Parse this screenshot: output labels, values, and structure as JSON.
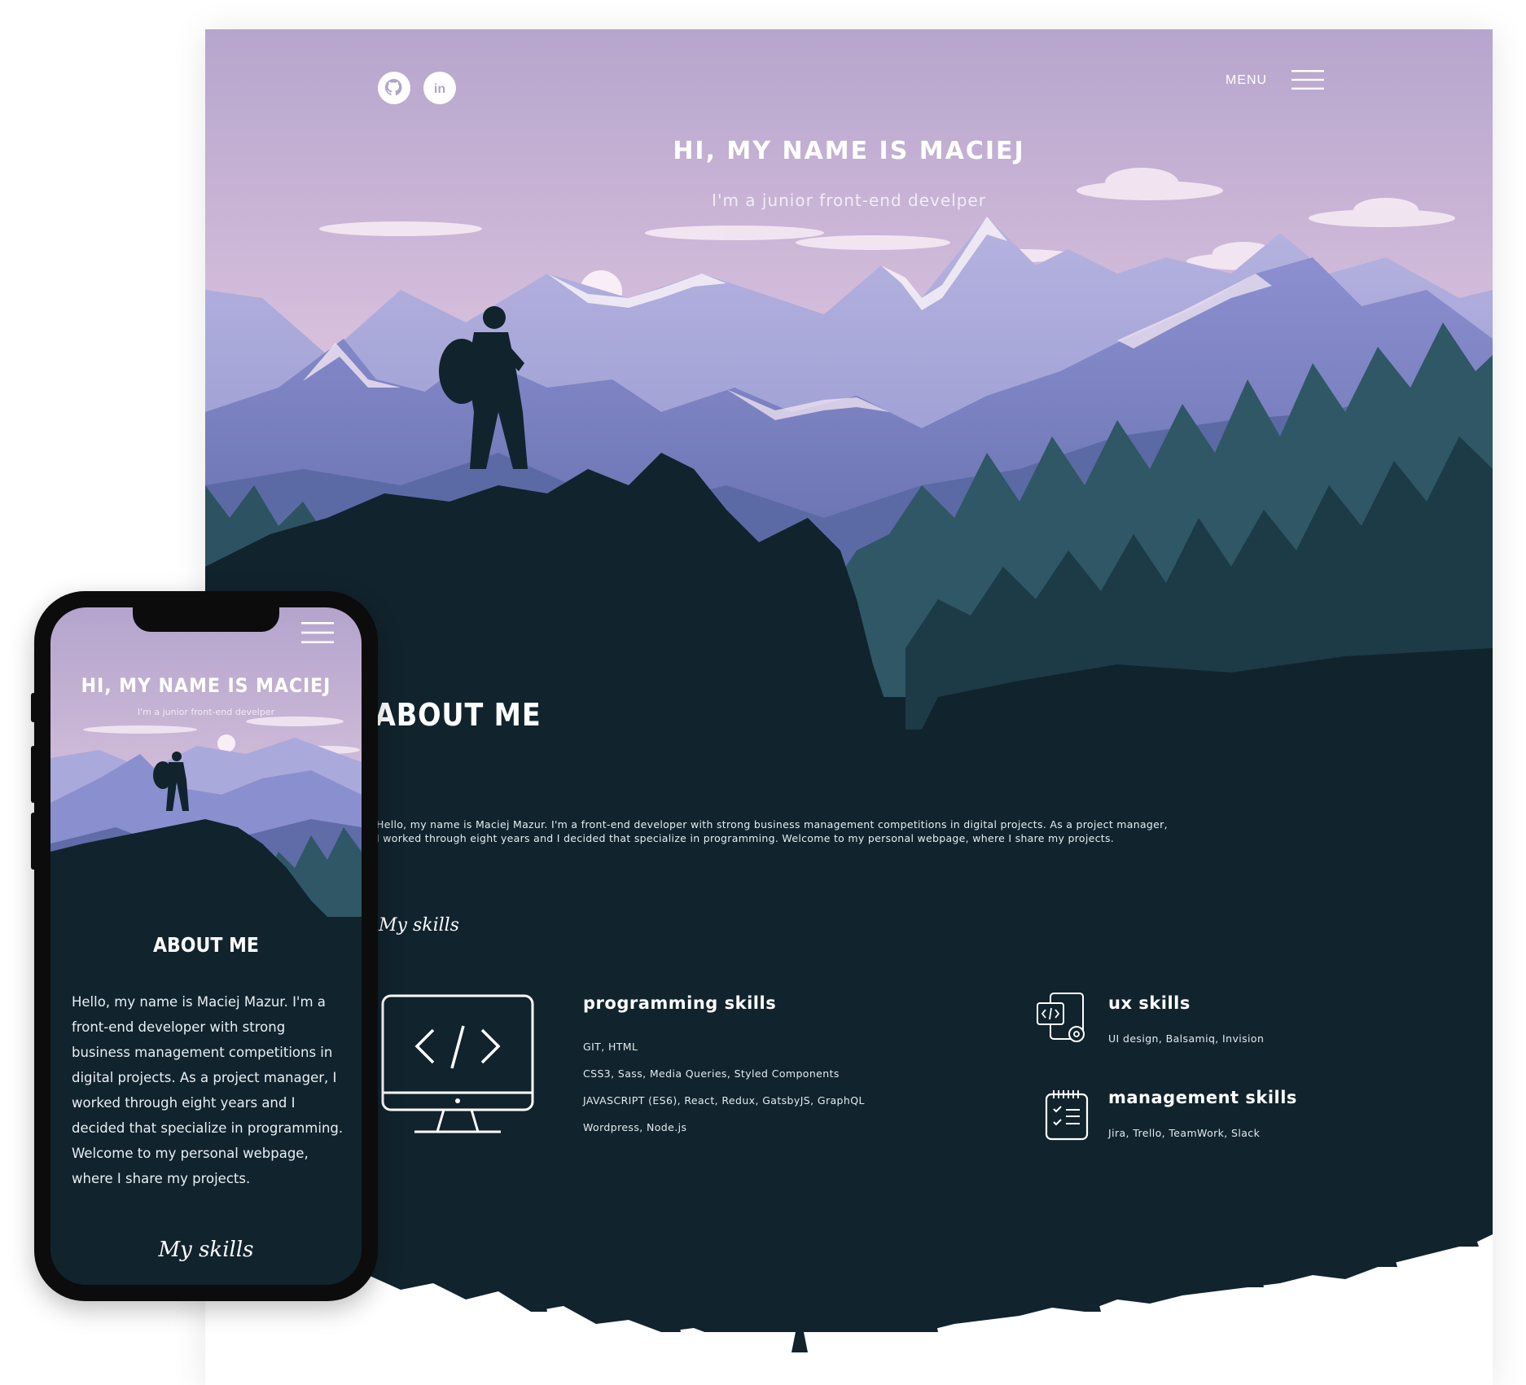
{
  "desktop": {
    "nav": {
      "menu_label": "MENU"
    },
    "hero": {
      "title": "HI, MY NAME IS MACIEJ",
      "subtitle": "I'm a junior front-end develper"
    },
    "about": {
      "title": "ABOUT ME",
      "paragraph_line1": "Hello, my name is Maciej Mazur. I'm a front-end developer with strong business management competitions in digital projects. As a project manager,",
      "paragraph_line2": "I worked through eight years and I decided that specialize in programming. Welcome to my personal webpage, where I share my projects."
    },
    "skills": {
      "title": "My skills",
      "programming": {
        "heading": "programming skills",
        "items": [
          "GIT, HTML",
          "CSS3, Sass, Media Queries, Styled Components",
          "JAVASCRIPT (ES6), React, Redux, GatsbyJS, GraphQL",
          "Wordpress, Node.js"
        ]
      },
      "ux": {
        "heading": "ux skills",
        "items": [
          "UI design, Balsamiq, Invision"
        ]
      },
      "management": {
        "heading": "management skills",
        "items": [
          "Jira, Trello, TeamWork, Slack"
        ]
      }
    }
  },
  "mobile": {
    "hero": {
      "title": "HI, MY NAME IS MACIEJ",
      "subtitle": "I'm a junior front-end develper"
    },
    "about": {
      "title": "ABOUT ME",
      "paragraph": "Hello, my name is Maciej Mazur. I'm a front-end developer with strong business management competitions in digital projects. As a project manager, I worked through eight years and I decided that specialize in programming. Welcome to my personal webpage, where I share my projects."
    },
    "skills": {
      "title": "My skills"
    }
  },
  "icons": {
    "github": "github-icon",
    "linkedin": "linkedin-icon",
    "menu": "hamburger-menu-icon",
    "programming": "monitor-code-icon",
    "ux": "devices-settings-icon",
    "management": "checklist-notepad-icon"
  },
  "colors": {
    "sky_top": "#b7a7cf",
    "sky_bottom": "#e6cde0",
    "mountain_far": "#a9a9d8",
    "mountain_mid": "#7f86c6",
    "forest": "#2f5766",
    "dark_background": "#11232d",
    "text_light": "#ffffff"
  }
}
